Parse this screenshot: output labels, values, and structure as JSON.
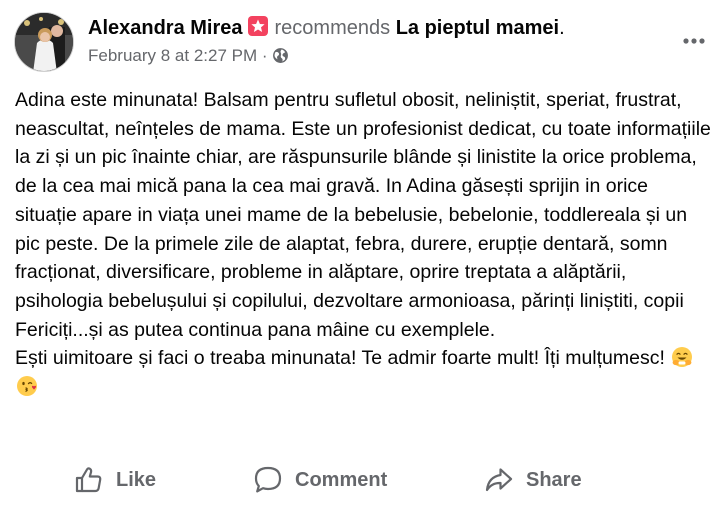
{
  "post": {
    "author": "Alexandra Mirea",
    "action_text": "recommends",
    "page": "La pieptul mamei",
    "period": ".",
    "timestamp": "February 8 at 2:27 PM",
    "dot": " · ",
    "privacy_icon": "globe-icon",
    "badge_icon": "star-badge-icon",
    "more_icon": "more-options-icon"
  },
  "body": {
    "paragraph1": "Adina este minunata! Balsam pentru sufletul obosit, neliniștit, speriat, frustrat, neascultat, neînțeles de mama. Este un profesionist dedicat, cu toate informațiile la zi și un pic înainte chiar, are răspunsurile blânde și linistite la orice problema, de la cea mai mică pana la cea mai gravă. In Adina găsești sprijin in orice situație apare in viața unei mame de la bebelusie, bebelonie, toddlereala și un pic peste. De la primele zile de alaptat, febra, durere, erupție dentară, somn fracționat, diversificare, probleme in alăptare, oprire treptata a alăptării, psihologia bebelușului și copilului, dezvoltare armonioasa, părinți liniștiti, copii Fericiți...și as putea continua pana mâine cu exemplele.",
    "paragraph2": "Ești uimitoare și faci o treaba minunata! Te admir foarte mult! Îți mulțumesc!",
    "emojis": [
      "hugging-face-emoji",
      "face-blowing-kiss-emoji"
    ]
  },
  "actions": {
    "like": "Like",
    "comment": "Comment",
    "share": "Share"
  },
  "colors": {
    "text_primary": "#050505",
    "text_secondary": "#65676b",
    "badge_pink": "#f3425f",
    "background": "#ffffff"
  }
}
